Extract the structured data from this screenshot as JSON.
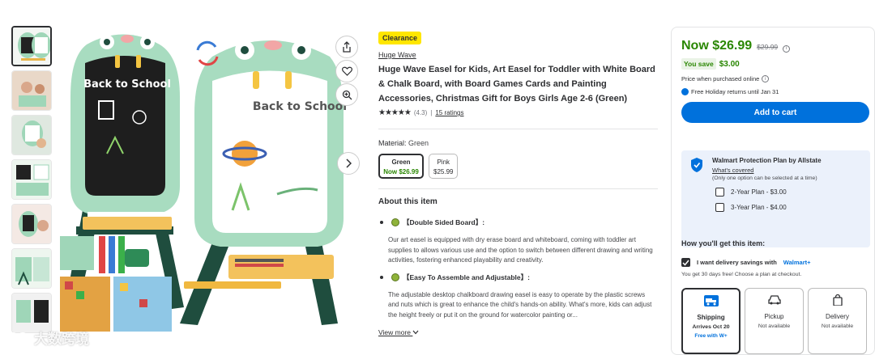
{
  "thumbnails": [
    "thumb-1",
    "thumb-2",
    "thumb-3",
    "thumb-4",
    "thumb-5",
    "thumb-6",
    "thumb-7"
  ],
  "image": {
    "board_text_left": "Back to School",
    "board_text_right": "Back to School"
  },
  "product": {
    "tag": "Clearance",
    "brand": "Huge Wave",
    "title": "Huge Wave Easel for Kids, Art Easel for Toddler with White Board & Chalk Board, with Board Games Cards and Painting Accessories, Christmas Gift for Boys Girls Age 2-6 (Green)",
    "stars": "★★★★★",
    "rating": "(4.3)",
    "sep": "|",
    "ratings_link": "15 ratings",
    "material_label": "Material:",
    "material_value": "Green",
    "variants": [
      {
        "name": "Green",
        "price": "Now $26.99"
      },
      {
        "name": "Pink",
        "price": "$25.99"
      }
    ],
    "about_title": "About this item",
    "bullets": [
      {
        "title": "【Double Sided Board】:",
        "text": "Our art easel is equipped with dry erase board and whiteboard, coming with toddler art supplies to allows various use and the option to switch between different drawing and writing activities, fostering enhanced playability and creativity."
      },
      {
        "title": "【Easy To Assemble and Adjustable】:",
        "text": "The adjustable desktop chalkboard drawing easel is easy to operate by the plastic screws and nuts which is great to enhance the child's hands-on ability. What's more, kids can adjust the height freely or put it on the ground for watercolor painting or..."
      }
    ],
    "view_more": "View more"
  },
  "buy_box": {
    "now_price": "Now $26.99",
    "was_price": "$29.99",
    "info_glyph": "i",
    "you_save_label": "You save",
    "you_save_amount": "$3.00",
    "price_when_purchased": "Price when purchased online",
    "returns": "Free Holiday returns until Jan 31",
    "add_to_cart": "Add to cart",
    "protection_title": "Walmart Protection Plan by Allstate",
    "whats_covered": "What's covered",
    "plan_note": "(Only one option can be selected at a time)",
    "plans": [
      "2-Year Plan - $3.00",
      "3-Year Plan - $4.00"
    ],
    "how_get": "How you'll get this item:",
    "delivery_savings": "I want delivery savings with",
    "walmart_word": "Walmart+",
    "delivery_note": "You get 30 days free! Choose a plan at checkout.",
    "fulfillment": [
      {
        "name": "Shipping",
        "sub": "Arrives Oct 20",
        "extra": "Free with W+"
      },
      {
        "name": "Pickup",
        "sub": "Not available"
      },
      {
        "name": "Delivery",
        "sub": "Not available"
      }
    ]
  },
  "watermark": "大数跨境",
  "colors": {
    "green": "#2a8703",
    "blue": "#0071dc",
    "yellow": "#ffe600",
    "easel_mint": "#a8dcc0",
    "easel_dark": "#1f4d3e"
  }
}
